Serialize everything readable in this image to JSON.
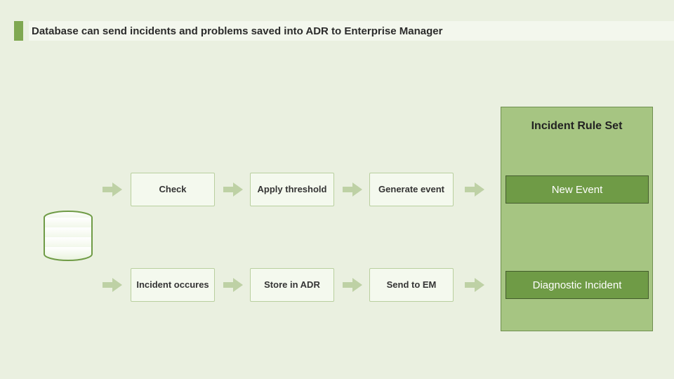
{
  "page": {
    "title": "Database can send incidents and problems saved into ADR to Enterprise Manager"
  },
  "ruleset": {
    "title": "Incident Rule Set"
  },
  "flow": {
    "top": {
      "steps": [
        "Check",
        "Apply threshold",
        "Generate event"
      ],
      "output": "New Event"
    },
    "bottom": {
      "steps": [
        "Incident occures",
        "Store in ADR",
        "Send to EM"
      ],
      "output": "Diagnostic Incident"
    }
  },
  "colors": {
    "accent": "#7fa851",
    "ruleset_bg": "#a6c582",
    "output_bg": "#6f9b46"
  },
  "chart_data": {
    "type": "diagram",
    "title": "Database can send incidents and problems saved into ADR to Enterprise Manager",
    "source_node": "Database",
    "flows": [
      {
        "steps": [
          "Check",
          "Apply threshold",
          "Generate event"
        ],
        "result": "New Event"
      },
      {
        "steps": [
          "Incident occures",
          "Store in ADR",
          "Send to EM"
        ],
        "result": "Diagnostic Incident"
      }
    ],
    "result_container": "Incident Rule Set"
  }
}
